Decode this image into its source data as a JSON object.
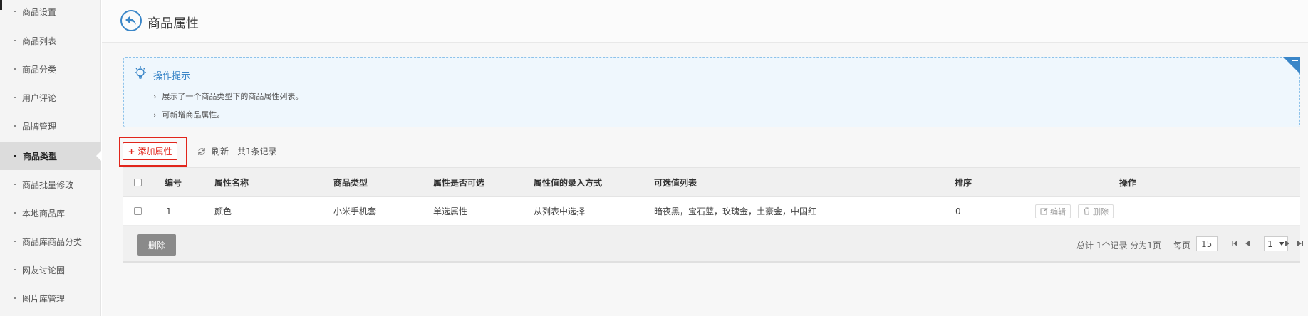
{
  "sidebar": {
    "items": [
      {
        "label": "商品设置"
      },
      {
        "label": "商品列表"
      },
      {
        "label": "商品分类"
      },
      {
        "label": "用户评论"
      },
      {
        "label": "品牌管理"
      },
      {
        "label": "商品类型",
        "active": true
      },
      {
        "label": "商品批量修改"
      },
      {
        "label": "本地商品库"
      },
      {
        "label": "商品库商品分类"
      },
      {
        "label": "网友讨论圈"
      },
      {
        "label": "图片库管理"
      }
    ]
  },
  "header": {
    "title": "商品属性",
    "back_icon": "back-arrow-icon"
  },
  "tips": {
    "title": "操作提示",
    "lines": [
      "展示了一个商品类型下的商品属性列表。",
      "可新增商品属性。"
    ]
  },
  "toolbar": {
    "add_label": "添加属性",
    "refresh_label": "刷新 - 共1条记录"
  },
  "table": {
    "headers": [
      "编号",
      "属性名称",
      "商品类型",
      "属性是否可选",
      "属性值的录入方式",
      "可选值列表",
      "排序",
      "操作"
    ],
    "rows": [
      {
        "id": "1",
        "name": "颜色",
        "type": "小米手机套",
        "selectable": "单选属性",
        "input_mode": "从列表中选择",
        "values": "暗夜黑，宝石蓝，玫瑰金，土豪金，中国红",
        "sort": "0",
        "edit_label": "编辑",
        "delete_label": "删除"
      }
    ]
  },
  "footer": {
    "delete_label": "删除",
    "summary": "总计 1个记录 分为1页",
    "per_page_label": "每页",
    "per_page_value": "15",
    "current_page": "1"
  },
  "colors": {
    "accent": "#3a86c8",
    "danger": "#e1251b",
    "tips_bg": "#eff7fd"
  }
}
